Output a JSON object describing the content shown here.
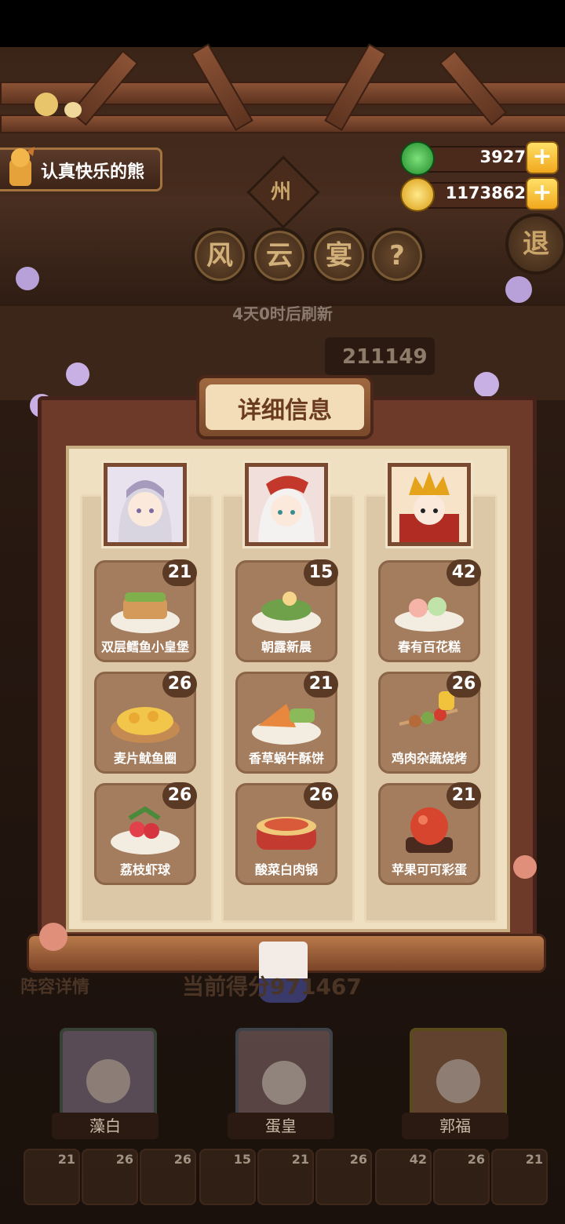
{
  "user": {
    "name": "认真快乐的熊"
  },
  "resources": {
    "jade": "3927",
    "coins": "1173862",
    "plus": "+"
  },
  "region_tag": "州",
  "title_chars": [
    "风",
    "云",
    "宴",
    "?"
  ],
  "exit_label": "退",
  "refresh_text": "4天0时后刷新",
  "score_back": "211149",
  "panel_title": "详细信息",
  "columns": [
    {
      "dishes": [
        {
          "name": "双层鳕鱼小皇堡",
          "count": "21"
        },
        {
          "name": "麦片鱿鱼圈",
          "count": "26"
        },
        {
          "name": "荔枝虾球",
          "count": "26"
        }
      ]
    },
    {
      "dishes": [
        {
          "name": "朝露新晨",
          "count": "15"
        },
        {
          "name": "香草蜗牛酥饼",
          "count": "21"
        },
        {
          "name": "酸菜白肉锅",
          "count": "26"
        }
      ]
    },
    {
      "dishes": [
        {
          "name": "春有百花糕",
          "count": "42"
        },
        {
          "name": "鸡肉杂蔬烧烤",
          "count": "26"
        },
        {
          "name": "苹果可可彩蛋",
          "count": "21"
        }
      ]
    }
  ],
  "bottom": {
    "lineup_label": "阵容详情",
    "current_score": "当前得分971467",
    "heroes": [
      "藻白",
      "蛋皇",
      "郭福"
    ],
    "mini_counts": [
      "21",
      "26",
      "26",
      "15",
      "21",
      "26",
      "42",
      "26",
      "21"
    ]
  },
  "colors": {
    "panel": "#6d3a2a",
    "paper": "#efe0c2",
    "card": "#a47d5e",
    "badge": "#5a3a25"
  }
}
